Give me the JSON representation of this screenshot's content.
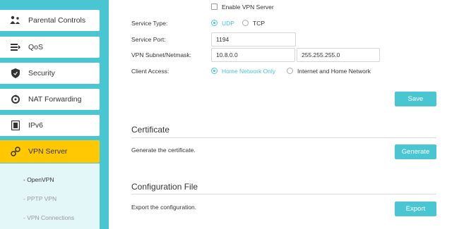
{
  "sidebar": {
    "items": [
      {
        "label": "Parental Controls",
        "icon": "family-icon"
      },
      {
        "label": "QoS",
        "icon": "qos-icon"
      },
      {
        "label": "Security",
        "icon": "shield-icon"
      },
      {
        "label": "NAT Forwarding",
        "icon": "nat-icon"
      },
      {
        "label": "IPv6",
        "icon": "ipv6-icon"
      },
      {
        "label": "VPN Server",
        "icon": "vpn-key-icon",
        "active": true
      }
    ],
    "submenu": [
      "- OpenVPN",
      "- PPTP VPN",
      "- VPN Connections"
    ]
  },
  "vpn_form": {
    "enable_label": "Enable VPN Server",
    "service_type_label": "Service Type:",
    "udp_label": "UDP",
    "tcp_label": "TCP",
    "service_port_label": "Service Port:",
    "service_port_value": "1194",
    "subnet_label": "VPN Subnet/Netmask:",
    "subnet_value": "10.8.0.0",
    "netmask_value": "255.255.255.0",
    "client_access_label": "Client Access:",
    "home_only_label": "Home Network Only",
    "internet_home_label": "Internet and Home Network",
    "save_label": "Save"
  },
  "certificate": {
    "title": "Certificate",
    "description": "Generate the certificate.",
    "button_label": "Generate"
  },
  "config_file": {
    "title": "Configuration File",
    "description": "Export the configuration.",
    "button_label": "Export"
  },
  "colors": {
    "accent": "#4ac6d2",
    "active": "#ffc800"
  }
}
